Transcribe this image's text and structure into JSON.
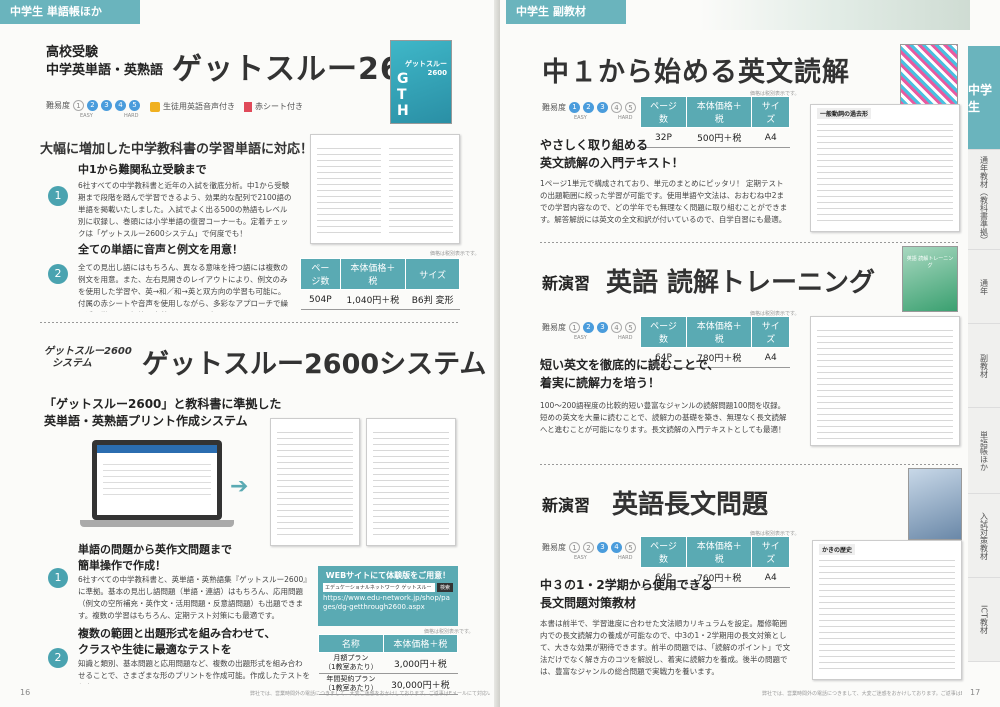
{
  "left": {
    "header": "中学生 単語帳ほか",
    "product1": {
      "subtitle_line1": "高校受験",
      "subtitle_line2": "中学英単語・英熟語",
      "title": "ゲットスルー2600",
      "difficulty_label": "難易度",
      "difficulty_easy": "EASY",
      "difficulty_hard": "HARD",
      "difficulty_levels": [
        "1",
        "2",
        "3",
        "4",
        "5"
      ],
      "audio_badge": "生徒用英語音声付き",
      "sheet_badge": "赤シート付き",
      "headline": "大幅に増加した中学教科書の学習単語に対応！",
      "point1_num": "1",
      "point1_title": "中1から難関私立受験まで",
      "point1_body": "6社すべての中学教科書と近年の入試を徹底分析。中1から受験期まで段階を踏んで学習できるよう、効果的な配列で2100語の単語を掲載いたしました。入試でよく出る500の熟語もレベル別に収録し、巻頭には小学単語の復習コーナーも。定着チェックは「ゲットスルー2600システム」で何度でも！",
      "point2_num": "2",
      "point2_title": "全ての単語に音声と例文を用意！",
      "point2_body": "全ての見出し語にはもちろん、異なる意味を持つ語には複数の例文を用意。また、左右見開きのレイアウトにより、例文のみを使用した学習や、英→和／和→英と双方向の学習も可能に。付属の赤シートや音声を使用しながら、多彩なアプローチで繰り返し学習し、記憶を定着させることができます。",
      "price_note": "価格は税別表示です。",
      "table_headers": [
        "ページ数",
        "本体価格＋税",
        "サイズ"
      ],
      "table_row": [
        "504P",
        "1,040円＋税",
        "B6判 変形"
      ],
      "book_cover_text": "ゲットスルー 2600"
    },
    "product2": {
      "logo_line1": "ゲットスルー2600",
      "logo_line2": "システム",
      "title": "ゲットスルー2600システム",
      "headline1": "「ゲットスルー2600」と教科書に準拠した",
      "headline2": "英単語・英熟語プリント作成システム",
      "point1_num": "1",
      "point1_title_line1": "単語の問題から英作文問題まで",
      "point1_title_line2": "簡単操作で作成！",
      "point1_body": "6社すべての中学教科書と、英単語・英熟語集『ゲットスルー2600』に準拠。基本の見出し語問題（単語・連語）はもちろん、応用問題（例文の空所補充・英作文・活用問題・反意語問題）も出題できます。複数の学習はもちろん、定期テスト対策にも最適です。",
      "point2_num": "2",
      "point2_title_line1": "複数の範囲と出題形式を組み合わせて、",
      "point2_title_line2": "クラスや生徒に最適なテストを",
      "point2_body": "知識と類別、基本問題と応用問題など、複数の出題形式を組み合わせることで、さまざまな形のプリントを作成可能。作成したテストを保存することもできます。",
      "web_box_title": "WEBサイトにて体験版をご用意！",
      "web_box_org": "エデュケーショナルネットワーク ゲットスルー",
      "web_box_search": "検索",
      "web_box_url": "https://www.edu-network.jp/shop/pages/dg-getthrough2600.aspx",
      "price_note": "価格は税別表示です。",
      "plan_headers": [
        "名称",
        "本体価格＋税"
      ],
      "plans": [
        {
          "name_line1": "月額プラン",
          "name_line2": "（1教室あたり）",
          "price": "3,000円＋税"
        },
        {
          "name_line1": "年間契約プラン",
          "name_line2": "（1教室あたり）",
          "price": "30,000円＋税"
        }
      ]
    },
    "page_number": "16",
    "footnote": "弊社では、営業時間外の電話につきまして、大変ご迷惑をおかけしております。ご返事はEメールにて対応いたしますのでご了承くださいませ。"
  },
  "right": {
    "header": "中学生 副教材",
    "product1": {
      "title": "中１から始める英文読解",
      "difficulty_label": "難易度",
      "difficulty_easy": "EASY",
      "difficulty_hard": "HARD",
      "difficulty_levels": [
        "1",
        "2",
        "3",
        "4",
        "5"
      ],
      "price_note": "価格は税別表示です。",
      "table_headers": [
        "ページ数",
        "本体価格＋税",
        "サイズ"
      ],
      "table_row": [
        "32P",
        "500円＋税",
        "A4"
      ],
      "headline1": "やさしく取り組める",
      "headline2": "英文読解の入門テキスト！",
      "body": "1ページ1単元で構成されており、単元のまとめにピッタリ！ 定期テストの出題範囲に絞った学習が可能です。使用単語や文法は、おおむね中2までの学習内容なので、どの学年でも無理なく問題に取り組むことができます。解答解説には英文の全文和訳が付いているので、自学自習にも最適。",
      "sheet_title": "一般動詞の過去形"
    },
    "product2": {
      "prefix": "新演習",
      "title": "英語 読解トレーニング",
      "difficulty_label": "難易度",
      "difficulty_easy": "EASY",
      "difficulty_hard": "HARD",
      "difficulty_levels": [
        "1",
        "2",
        "3",
        "4",
        "5"
      ],
      "price_note": "価格は税別表示です。",
      "table_headers": [
        "ページ数",
        "本体価格＋税",
        "サイズ"
      ],
      "table_row": [
        "64P",
        "780円＋税",
        "A4"
      ],
      "headline1": "短い英文を徹底的に読むことで、",
      "headline2": "着実に読解力を培う！",
      "body": "100〜200語程度の比較的短い豊富なジャンルの読解問題100問を収録。短めの英文を大量に読むことで、読解力の基礎を築き、無理なく長文読解へと進むことが可能になります。長文読解の入門テキストとしても最適！",
      "cover_text": "英語 読解トレーニング"
    },
    "product3": {
      "prefix": "新演習",
      "title": "英語長文問題",
      "difficulty_label": "難易度",
      "difficulty_easy": "EASY",
      "difficulty_hard": "HARD",
      "difficulty_levels": [
        "1",
        "2",
        "3",
        "4",
        "5"
      ],
      "price_note": "価格は税別表示です。",
      "table_headers": [
        "ページ数",
        "本体価格＋税",
        "サイズ"
      ],
      "table_row": [
        "64P",
        "760円＋税",
        "A4"
      ],
      "headline1": "中３の1・2学期から使用できる",
      "headline2": "長文問題対策教材",
      "body": "本書は前半で、学習進度に合わせた文法順カリキュラムを設定。履修範囲内での長文読解力の養成が可能なので、中3の1・2学期用の長文対策として、大きな効果が期待できます。前半の問題では、「読解のポイント」で文法だけでなく解き方のコツを解説し、着実に読解力を養成。後半の問題では、豊富なジャンルの総合問題で実戦力を養います。",
      "sheet_title": "かきの歴史"
    },
    "side_tabs": [
      "中学生",
      "通年教材（教科書準拠）",
      "通年",
      "副教材",
      "単語帳ほか",
      "入試対策教材",
      "ICT教材"
    ],
    "page_number": "17",
    "footnote": "弊社では、営業時間外の電話につきまして、大変ご迷惑をおかけしております。ご返事はEメールにて対応いたしますのでご了承くださいませ。"
  },
  "colors": {
    "accent": "#5aaab3",
    "header": "#6ab4bd",
    "dot": "#4a9cdc"
  }
}
